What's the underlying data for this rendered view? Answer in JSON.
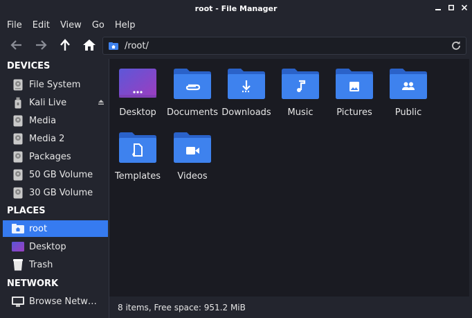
{
  "window": {
    "title": "root - File Manager"
  },
  "menu": [
    "File",
    "Edit",
    "View",
    "Go",
    "Help"
  ],
  "toolbar": {
    "path": "/root/"
  },
  "sidebar": {
    "devices_heading": "DEVICES",
    "devices": [
      {
        "label": "File System",
        "icon": "harddisk-icon"
      },
      {
        "label": "Kali Live",
        "icon": "usb-drive-icon"
      },
      {
        "label": "Media",
        "icon": "drive-icon"
      },
      {
        "label": "Media 2",
        "icon": "drive-icon"
      },
      {
        "label": "Packages",
        "icon": "drive-icon"
      },
      {
        "label": "50 GB Volume",
        "icon": "drive-icon"
      },
      {
        "label": "30 GB Volume",
        "icon": "drive-icon"
      }
    ],
    "places_heading": "PLACES",
    "places": [
      {
        "label": "root",
        "icon": "home-folder-icon",
        "selected": true
      },
      {
        "label": "Desktop",
        "icon": "desktop-icon"
      },
      {
        "label": "Trash",
        "icon": "trash-icon"
      }
    ],
    "network_heading": "NETWORK",
    "network": [
      {
        "label": "Browse Netw…",
        "icon": "network-monitor-icon"
      }
    ]
  },
  "files": [
    {
      "name": "Desktop",
      "icon": "desktop-folder-icon"
    },
    {
      "name": "Documents",
      "icon": "documents-folder-icon"
    },
    {
      "name": "Downloads",
      "icon": "downloads-folder-icon"
    },
    {
      "name": "Music",
      "icon": "music-folder-icon"
    },
    {
      "name": "Pictures",
      "icon": "pictures-folder-icon"
    },
    {
      "name": "Public",
      "icon": "public-folder-icon"
    },
    {
      "name": "Templates",
      "icon": "templates-folder-icon"
    },
    {
      "name": "Videos",
      "icon": "videos-folder-icon"
    }
  ],
  "status": {
    "text": "8 items, Free space: 951.2 MiB"
  },
  "colors": {
    "accent": "#367bf0",
    "folder": "#3e82ee",
    "folder_dark": "#2a62c9",
    "background": "#1a1b22"
  }
}
